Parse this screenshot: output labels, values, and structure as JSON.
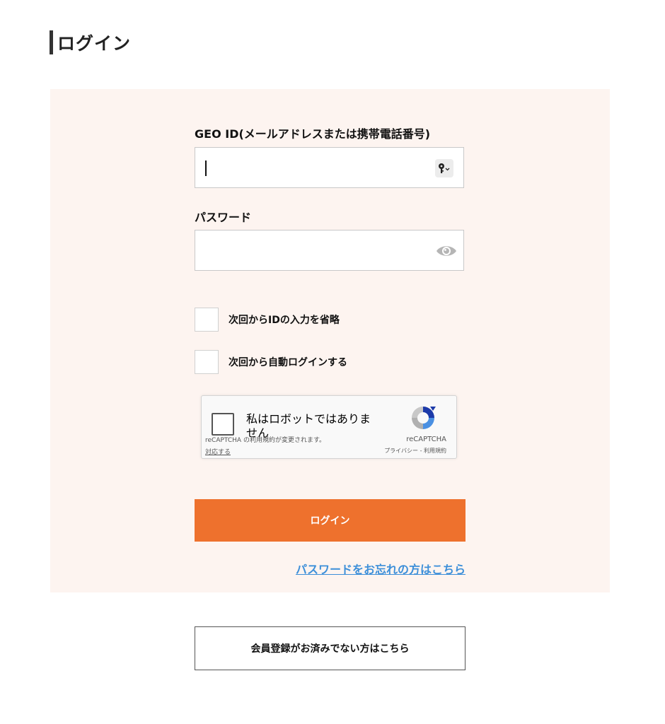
{
  "page": {
    "title": "ログイン"
  },
  "form": {
    "id_label": "GEO ID(メールアドレスまたは携帯電話番号)",
    "id_value": "",
    "password_label": "パスワード",
    "password_value": "",
    "remember_id_label": "次回からIDの入力を省略",
    "auto_login_label": "次回から自動ログインする",
    "login_button_label": "ログイン",
    "forgot_password_link": "パスワードをお忘れの方はこちら"
  },
  "recaptcha": {
    "checkbox_label": "私はロボットではありません",
    "notice": "reCAPTCHA の利用規約が変更されます。",
    "respond_link": "対応する",
    "brand": "reCAPTCHA",
    "links": "プライバシー - 利用規約"
  },
  "footer": {
    "register_button_label": "会員登録がお済みでない方はこちら"
  },
  "icons": {
    "key": "key-icon",
    "eye": "eye-icon",
    "recaptcha_logo": "recaptcha-logo-icon"
  },
  "colors": {
    "panel_background": "#fdf4f0",
    "primary_button": "#ee712d",
    "link": "#3d8fd9"
  }
}
